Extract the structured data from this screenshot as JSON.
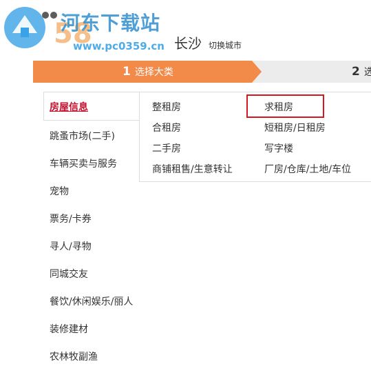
{
  "watermark": {
    "site_name": "河东下载站",
    "url": "www.pc0359.cn"
  },
  "logo": {
    "brand": "58"
  },
  "header": {
    "city": "长沙",
    "switch_city": "切换城市"
  },
  "steps": [
    {
      "number": "1",
      "label": "选择大类"
    },
    {
      "number": "2",
      "label": "选"
    }
  ],
  "categories": {
    "active": "房屋信息",
    "items": [
      "跳蚤市场(二手)",
      "车辆买卖与服务",
      "宠物",
      "票务/卡券",
      "寻人/寻物",
      "同城交友",
      "餐饮/休闲娱乐/丽人",
      "装修建材",
      "农林牧副渔"
    ]
  },
  "subcategories": {
    "col1": [
      "整租房",
      "合租房",
      "二手房",
      "商铺租售/生意转让"
    ],
    "col2": [
      "求租房",
      "短租房/日租房",
      "写字楼",
      "厂房/仓库/土地/车位"
    ]
  },
  "colors": {
    "accent": "#f28a4a",
    "active_text": "#c8102e",
    "highlight": "#d4181e"
  }
}
